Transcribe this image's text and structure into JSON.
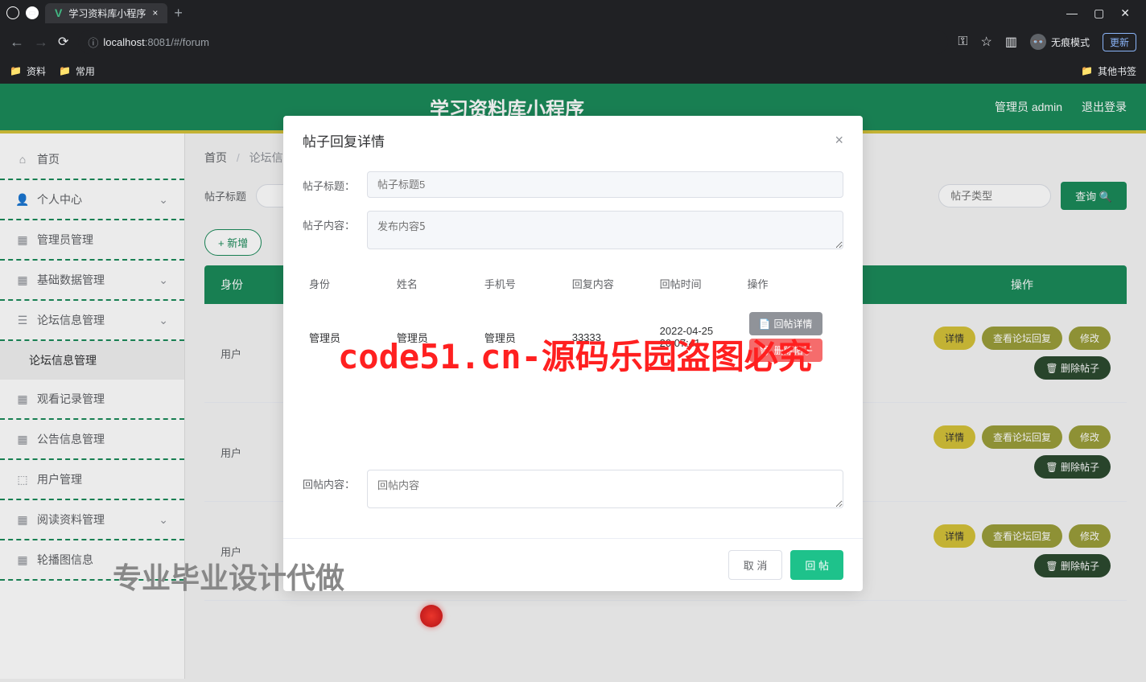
{
  "browser": {
    "tab_title": "学习资料库小程序",
    "url_host": "localhost",
    "url_port": ":8081",
    "url_path": "/#/forum",
    "incognito": "无痕模式",
    "update": "更新",
    "bookmarks": {
      "b1": "资料",
      "b2": "常用",
      "other": "其他书签"
    }
  },
  "header": {
    "title": "学习资料库小程序",
    "admin": "管理员 admin",
    "logout": "退出登录"
  },
  "sidebar": {
    "items": [
      {
        "label": "首页"
      },
      {
        "label": "个人中心"
      },
      {
        "label": "管理员管理"
      },
      {
        "label": "基础数据管理"
      },
      {
        "label": "论坛信息管理"
      },
      {
        "label": "论坛信息管理"
      },
      {
        "label": "观看记录管理"
      },
      {
        "label": "公告信息管理"
      },
      {
        "label": "用户管理"
      },
      {
        "label": "阅读资料管理"
      },
      {
        "label": "轮播图信息"
      }
    ]
  },
  "breadcrumb": {
    "home": "首页",
    "current": "论坛信息"
  },
  "filters": {
    "label_title": "帖子标题",
    "label_type": "帖子类型",
    "search": "查询",
    "add": "+ 新增"
  },
  "table": {
    "th_identity": "身份",
    "th_ops": "操作",
    "identity_user": "用户",
    "btn_detail": "详情",
    "btn_view_reply": "查看论坛回复",
    "btn_edit": "修改",
    "btn_delete": "删除帖子"
  },
  "modal": {
    "title": "帖子回复详情",
    "label_title": "帖子标题：",
    "placeholder_title": "帖子标题5",
    "label_content": "帖子内容：",
    "placeholder_content": "发布内容5",
    "th_identity": "身份",
    "th_name": "姓名",
    "th_phone": "手机号",
    "th_reply": "回复内容",
    "th_time": "回帖时间",
    "th_ops": "操作",
    "row": {
      "identity": "管理员",
      "name": "管理员",
      "phone": "管理员",
      "reply": "33333",
      "time": "2022-04-25 20:07:41"
    },
    "btn_reply_detail": "回帖详情",
    "btn_delete_post": "删除帖子",
    "label_reply_content": "回帖内容：",
    "placeholder_reply": "回帖内容",
    "cancel": "取 消",
    "submit": "回 帖"
  },
  "watermarks": {
    "red": "code51.cn-源码乐园盗图必究",
    "gray": "专业毕业设计代做",
    "wm": "code51.cn"
  }
}
